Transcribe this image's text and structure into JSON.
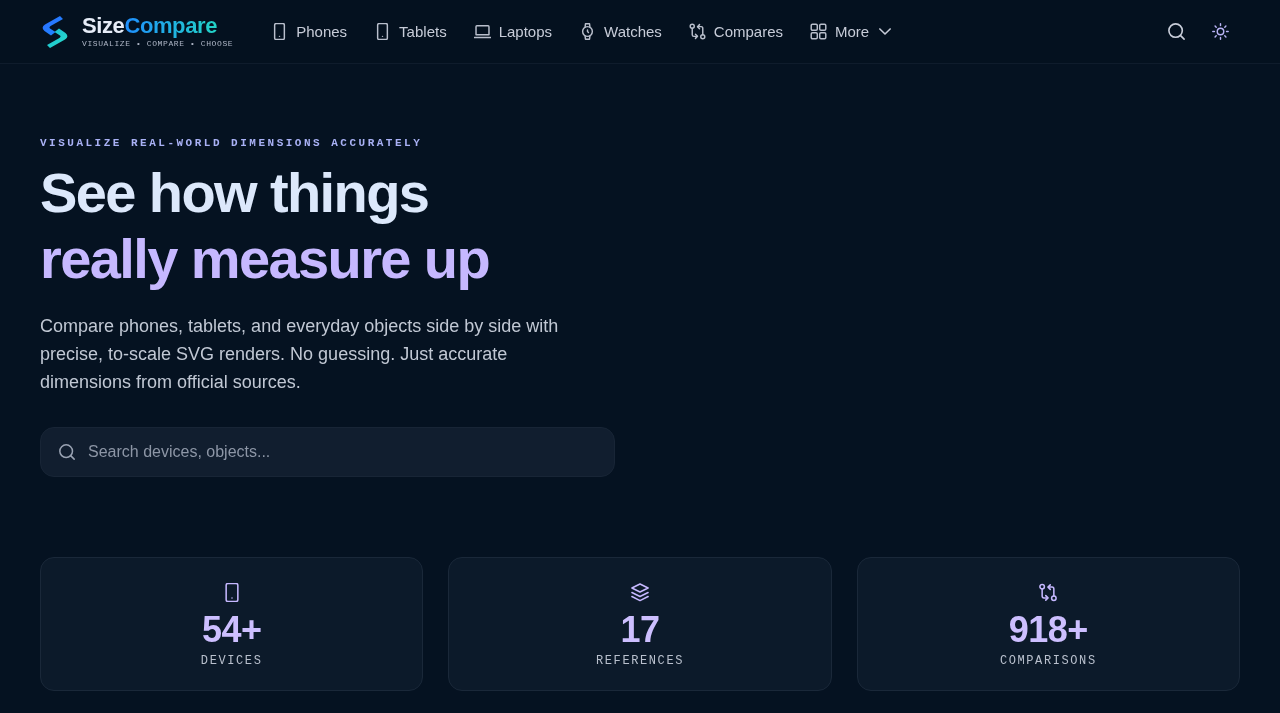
{
  "header": {
    "brand": {
      "name_parts": [
        "Size",
        "Compare"
      ],
      "tagline": "VISUALIZE • COMPARE • CHOOSE"
    },
    "nav": [
      {
        "label": "Phones",
        "kind": "link"
      },
      {
        "label": "Tablets",
        "kind": "link"
      },
      {
        "label": "Laptops",
        "kind": "link"
      },
      {
        "label": "Watches",
        "kind": "link"
      },
      {
        "label": "Compares",
        "kind": "link"
      },
      {
        "label": "More",
        "kind": "menu"
      }
    ]
  },
  "hero": {
    "eyebrow": "VISUALIZE REAL-WORLD DIMENSIONS ACCURATELY",
    "headline": [
      {
        "text": "See how things",
        "accent": false
      },
      {
        "text": "really measure up",
        "accent": true
      }
    ],
    "description": "Compare phones, tablets, and everyday objects side by side with precise, to-scale SVG renders. No guessing. Just accurate dimensions from official sources.",
    "search": {
      "placeholder": "Search devices, objects..."
    }
  },
  "stats": [
    {
      "value": "54+",
      "label": "DEVICES"
    },
    {
      "value": "17",
      "label": "REFERENCES"
    },
    {
      "value": "918+",
      "label": "COMPARISONS"
    }
  ]
}
